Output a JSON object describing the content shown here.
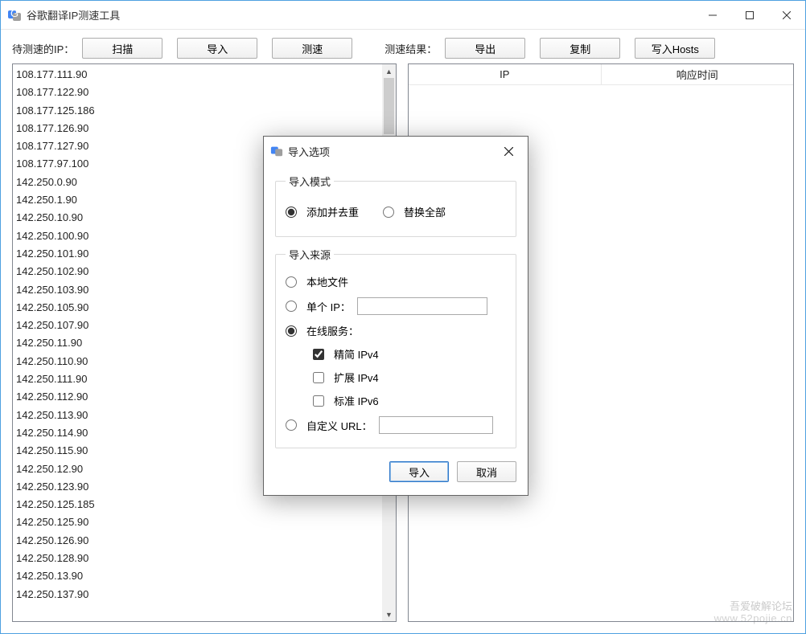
{
  "window": {
    "title": "谷歌翻译IP测速工具",
    "controls": {
      "min": "—",
      "max": "☐",
      "close": "✕"
    }
  },
  "toolbar": {
    "label_pending": "待测速的IP：",
    "btn_scan": "扫描",
    "btn_import": "导入",
    "btn_test": "测速",
    "label_results": "测速结果：",
    "btn_export": "导出",
    "btn_copy": "复制",
    "btn_hosts": "写入Hosts"
  },
  "ip_list": [
    "108.177.111.90",
    "108.177.122.90",
    "108.177.125.186",
    "108.177.126.90",
    "108.177.127.90",
    "108.177.97.100",
    "142.250.0.90",
    "142.250.1.90",
    "142.250.10.90",
    "142.250.100.90",
    "142.250.101.90",
    "142.250.102.90",
    "142.250.103.90",
    "142.250.105.90",
    "142.250.107.90",
    "142.250.11.90",
    "142.250.110.90",
    "142.250.111.90",
    "142.250.112.90",
    "142.250.113.90",
    "142.250.114.90",
    "142.250.115.90",
    "142.250.12.90",
    "142.250.123.90",
    "142.250.125.185",
    "142.250.125.90",
    "142.250.126.90",
    "142.250.128.90",
    "142.250.13.90",
    "142.250.137.90"
  ],
  "results": {
    "col_ip": "IP",
    "col_time": "响应时间"
  },
  "dialog": {
    "title": "导入选项",
    "group_mode": "导入模式",
    "mode_append": "添加并去重",
    "mode_replace": "替换全部",
    "group_source": "导入来源",
    "src_local": "本地文件",
    "src_single_ip": "单个 IP：",
    "src_online": "在线服务：",
    "chk_ipv4_lite": "精简 IPv4",
    "chk_ipv4_ext": "扩展 IPv4",
    "chk_ipv6_std": "标准 IPv6",
    "src_custom_url": "自定义 URL：",
    "btn_ok": "导入",
    "btn_cancel": "取消",
    "single_ip_value": "",
    "custom_url_value": ""
  },
  "watermark": {
    "line1": "吾爱破解论坛",
    "line2": "www.52pojie.cn"
  }
}
